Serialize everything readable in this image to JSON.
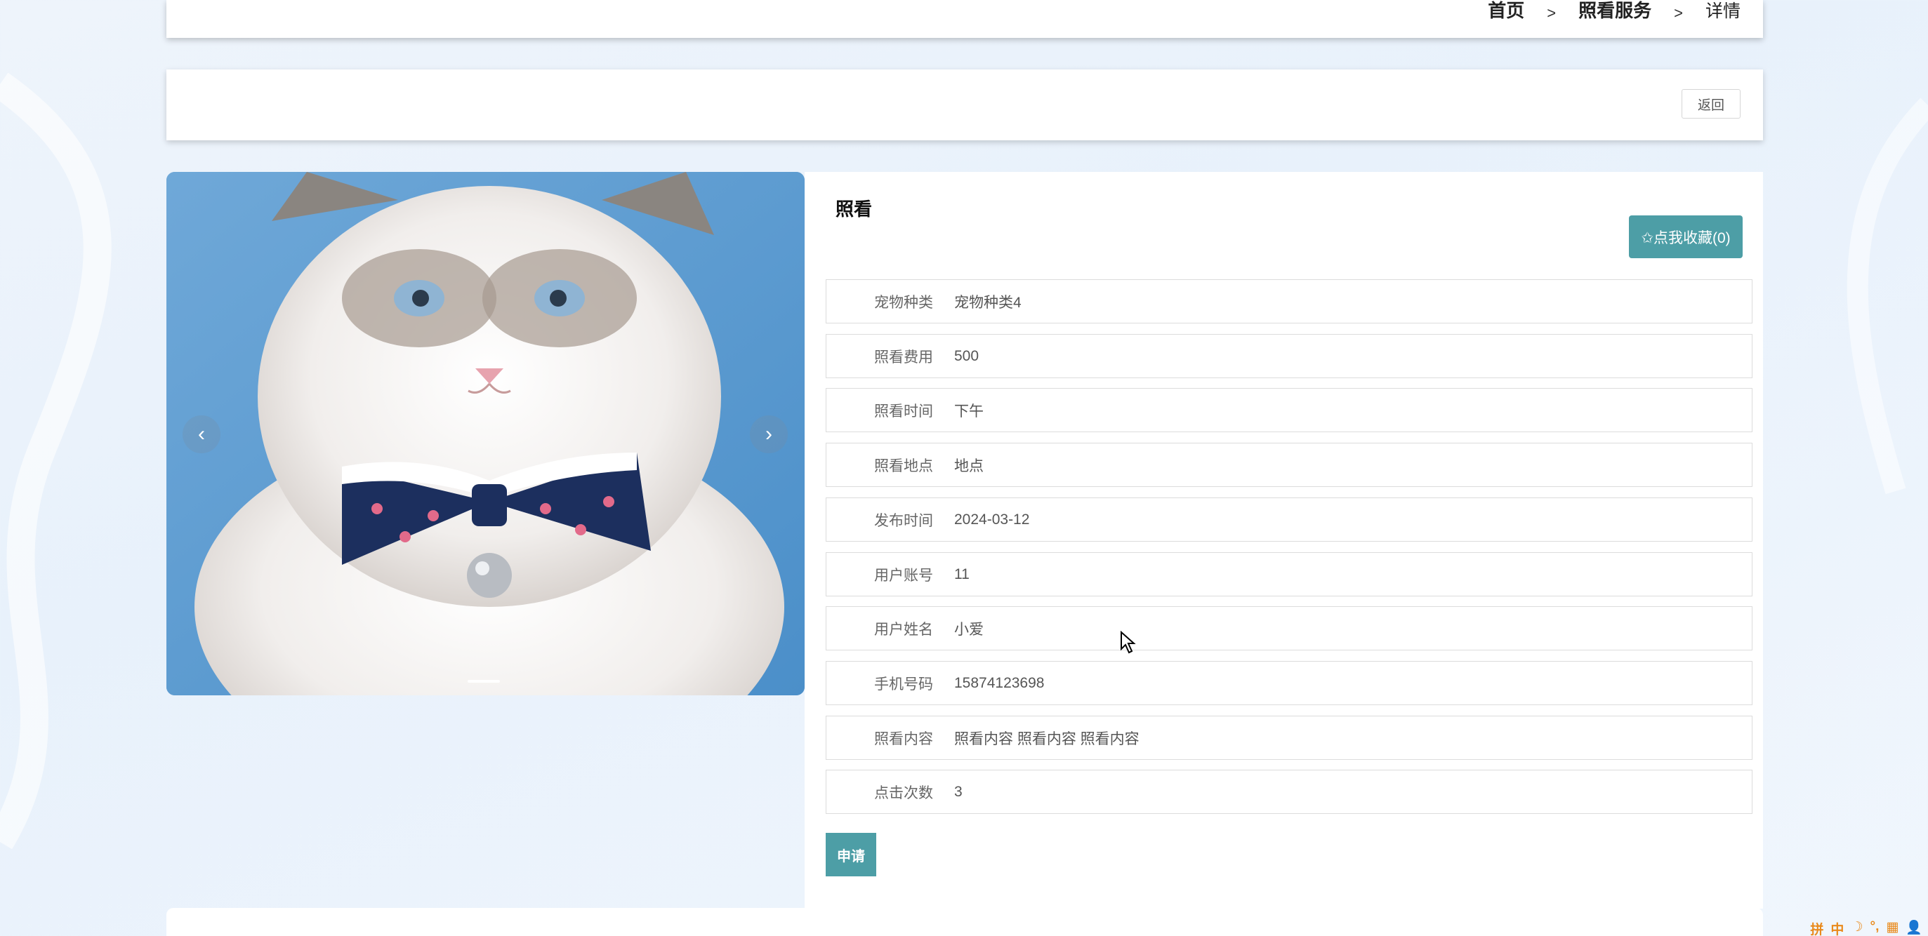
{
  "breadcrumb": {
    "home": "首页",
    "section": "照看服务",
    "current": "详情",
    "separator": ">"
  },
  "actions": {
    "back_label": "返回"
  },
  "carousel": {
    "prev_icon": "‹",
    "next_icon": "›",
    "image_subject": "white ragdoll cat wearing a navy polka-dot bow tie with bell, blue background"
  },
  "detail": {
    "title": "照看",
    "favorite_label": "✩点我收藏(0)",
    "fields": [
      {
        "label": "宠物种类",
        "value": "宠物种类4"
      },
      {
        "label": "照看费用",
        "value": "500"
      },
      {
        "label": "照看时间",
        "value": "下午"
      },
      {
        "label": "照看地点",
        "value": "地点"
      },
      {
        "label": "发布时间",
        "value": "2024-03-12"
      },
      {
        "label": "用户账号",
        "value": "11"
      },
      {
        "label": "用户姓名",
        "value": "小爱"
      },
      {
        "label": "手机号码",
        "value": "15874123698"
      },
      {
        "label": "照看内容",
        "value": "照看内容 照看内容 照看内容"
      },
      {
        "label": "点击次数",
        "value": "3"
      }
    ],
    "apply_label": "申请"
  },
  "tray": {
    "items": [
      "拼",
      "中",
      "☽",
      "°,",
      "▦",
      "👤"
    ]
  },
  "colors": {
    "accent": "#4d9ea6",
    "page_bg": "#eef4fb"
  }
}
